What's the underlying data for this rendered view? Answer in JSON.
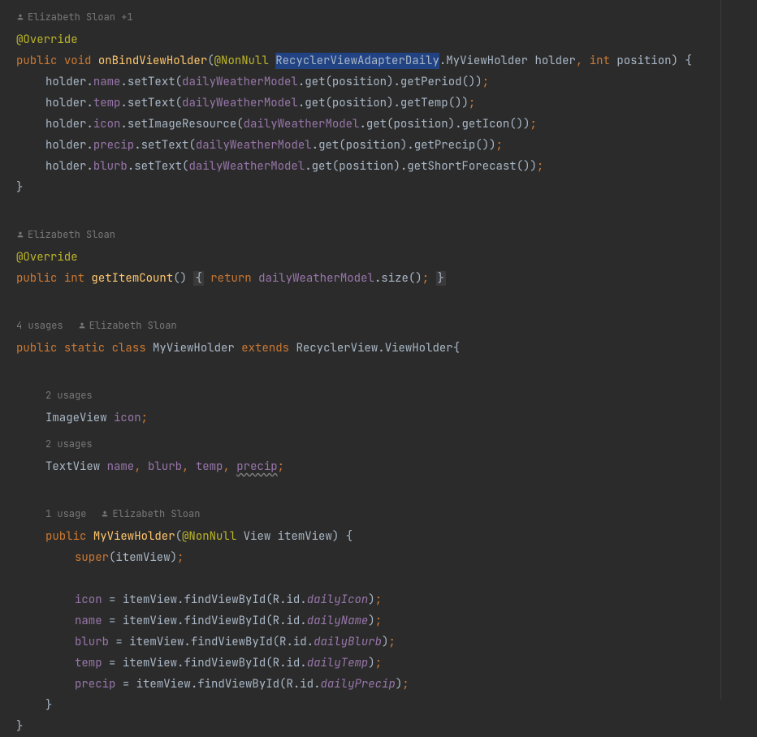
{
  "hints": {
    "author1": "Elizabeth Sloan +1",
    "author2": "Elizabeth Sloan",
    "author3": "Elizabeth Sloan",
    "author4": "Elizabeth Sloan",
    "usages4": "4 usages",
    "usages2a": "2 usages",
    "usages2b": "2 usages",
    "usages1": "1 usage"
  },
  "tok": {
    "override": "@Override",
    "public": "public",
    "void": "void",
    "int": "int",
    "static": "static",
    "class": "class",
    "extends": "extends",
    "return": "return",
    "super": "super",
    "nonnull": "@NonNull",
    "onBind": "onBindViewHolder",
    "getItemCount": "getItemCount",
    "MyViewHolder": "MyViewHolder",
    "RecyclerViewAdapterDaily": "RecyclerViewAdapterDaily",
    "RecyclerView": "RecyclerView",
    "ViewHolder": "ViewHolder",
    "ImageView": "ImageView",
    "TextView": "TextView",
    "View": "View",
    "holder": "holder",
    "position": "position",
    "itemView": "itemView",
    "name": "name",
    "temp": "temp",
    "icon": "icon",
    "precip": "precip",
    "blurb": "blurb",
    "dailyWeatherModel": "dailyWeatherModel",
    "setText": "setText",
    "setImageResource": "setImageResource",
    "get": "get",
    "getPeriod": "getPeriod",
    "getTemp": "getTemp",
    "getIcon": "getIcon",
    "getPrecip": "getPrecip",
    "getShortForecast": "getShortForecast",
    "size": "size",
    "findViewById": "findViewById",
    "R": "R",
    "id": "id",
    "dailyIcon": "dailyIcon",
    "dailyName": "dailyName",
    "dailyBlurb": "dailyBlurb",
    "dailyTemp": "dailyTemp",
    "dailyPrecip": "dailyPrecip"
  }
}
